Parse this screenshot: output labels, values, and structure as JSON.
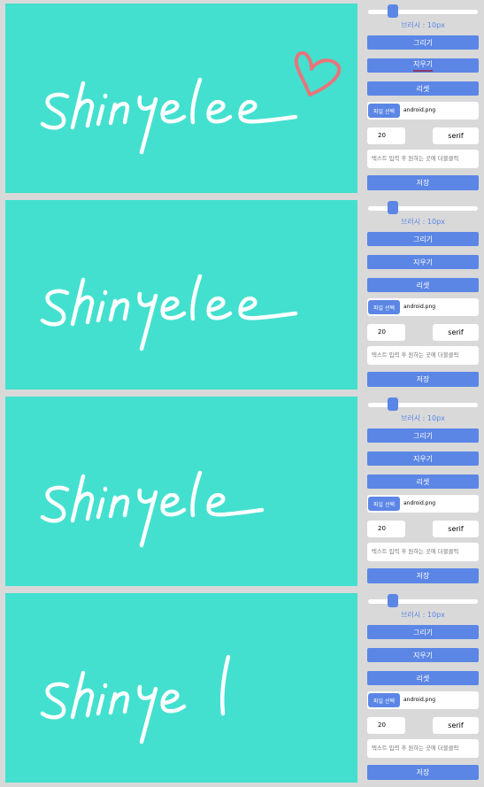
{
  "panels": [
    {
      "brush_label": "브러시 : 10px",
      "draw_label": "그리기",
      "erase_label": "지우기",
      "reset_label": "리셋",
      "file_button_label": "파일 선택",
      "file_name": "android.png",
      "font_size_value": "20",
      "font_family_value": "serif",
      "text_placeholder": "텍스트 입력 후 원하는 곳에 더블클릭",
      "save_label": "저장"
    },
    {
      "brush_label": "브러시 : 10px",
      "draw_label": "그리기",
      "erase_label": "지우기",
      "reset_label": "리셋",
      "file_button_label": "파일 선택",
      "file_name": "android.png",
      "font_size_value": "20",
      "font_family_value": "serif",
      "text_placeholder": "텍스트 입력 후 원하는 곳에 더블클릭",
      "save_label": "저장"
    },
    {
      "brush_label": "브러시 : 10px",
      "draw_label": "그리기",
      "erase_label": "지우기",
      "reset_label": "리셋",
      "file_button_label": "파일 선택",
      "file_name": "android.png",
      "font_size_value": "20",
      "font_family_value": "serif",
      "text_placeholder": "텍스트 입력 후 원하는 곳에 더블클릭",
      "save_label": "저장"
    },
    {
      "brush_label": "브러시 : 10px",
      "draw_label": "그리기",
      "erase_label": "지우기",
      "reset_label": "리셋",
      "file_button_label": "파일 선택",
      "file_name": "android.png",
      "font_size_value": "20",
      "font_family_value": "serif",
      "text_placeholder": "텍스트 입력 후 원하는 곳에 더블클릭",
      "save_label": "저장"
    }
  ],
  "colors": {
    "canvas": "#43e0cf",
    "accent": "#5b86e5",
    "background": "#d9d9d9",
    "heart": "#e8747a"
  }
}
